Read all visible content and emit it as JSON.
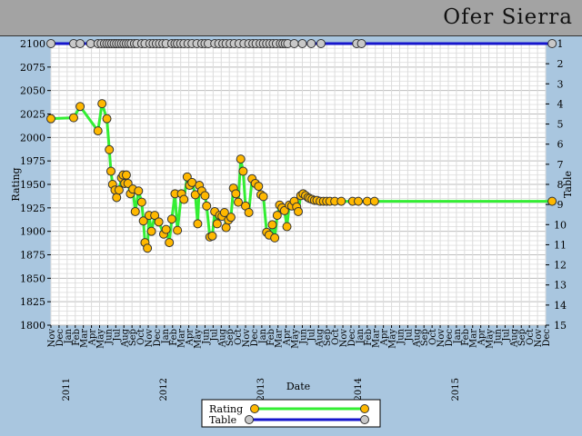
{
  "header": {
    "player_name": "Ofer Sierra"
  },
  "colors": {
    "rating_line": "#33ee33",
    "table_line": "#1515cc",
    "rating_marker": "#ffb800",
    "table_marker": "#c8c8c8",
    "background": "#a9c6df",
    "title_bar": "#a3a3a3"
  },
  "chart_data": {
    "type": "line",
    "title": "",
    "xlabel": "Date",
    "ylabel": "Rating",
    "y2label": "Table",
    "ylim": [
      1800,
      2100
    ],
    "y2lim": [
      1,
      15
    ],
    "y_ticks": [
      "1800",
      "1825",
      "1850",
      "1875",
      "1900",
      "1925",
      "1950",
      "1975",
      "2000",
      "2025",
      "2050",
      "2075",
      "2100"
    ],
    "y2_ticks": [
      "1",
      "2",
      "3",
      "4",
      "5",
      "6",
      "7",
      "8",
      "9",
      "10",
      "11",
      "12",
      "13",
      "14",
      "15"
    ],
    "month_ticks": [
      "Nov",
      "Dec",
      "Jan",
      "Feb",
      "Mar",
      "Apr",
      "May",
      "Jun",
      "Jul",
      "Aug",
      "Sep",
      "Oct",
      "Nov",
      "Dec",
      "Jan",
      "Feb",
      "Mar",
      "Apr",
      "May",
      "Jun",
      "Jul",
      "Aug",
      "Sep",
      "Oct",
      "Nov",
      "Dec",
      "Jan",
      "Feb",
      "Mar",
      "Apr",
      "May",
      "Jun",
      "Jul",
      "Aug",
      "Sep",
      "Oct",
      "Nov",
      "Dec",
      "Jan",
      "Feb",
      "Mar",
      "Apr",
      "May",
      "Jun",
      "Jul",
      "Aug",
      "Sep",
      "Oct",
      "Nov",
      "Dec",
      "Jan",
      "Feb",
      "Mar",
      "Apr",
      "May",
      "Jun",
      "Jul",
      "Aug",
      "Sep",
      "Oct",
      "Nov",
      "Dec"
    ],
    "year_labels": [
      {
        "label": "2011",
        "month_index": 2
      },
      {
        "label": "2012",
        "month_index": 14
      },
      {
        "label": "2013",
        "month_index": 26
      },
      {
        "label": "2014",
        "month_index": 38
      },
      {
        "label": "2015",
        "month_index": 50
      }
    ],
    "legend": {
      "placement": "bottom-center",
      "entries": [
        "Rating",
        "Table"
      ]
    },
    "grid": true,
    "series": [
      {
        "name": "Rating",
        "axis": "left",
        "x": [
          0,
          2.8,
          3.6,
          5.8,
          6.3,
          6.9,
          7.2,
          7.4,
          7.6,
          7.9,
          8.1,
          8.4,
          8.7,
          8.9,
          9.1,
          9.3,
          9.5,
          9.8,
          10.1,
          10.4,
          10.8,
          11.2,
          11.4,
          11.6,
          11.9,
          12.1,
          12.4,
          12.8,
          13.3,
          13.9,
          14.2,
          14.6,
          14.9,
          15.3,
          15.6,
          16.1,
          16.4,
          16.8,
          17.1,
          17.4,
          17.8,
          18.1,
          18.3,
          18.6,
          19.0,
          19.2,
          19.6,
          19.9,
          20.2,
          20.5,
          20.8,
          21.1,
          21.4,
          21.6,
          21.9,
          22.2,
          22.5,
          22.8,
          23.1,
          23.4,
          23.7,
          24.0,
          24.4,
          24.8,
          25.2,
          25.6,
          25.9,
          26.2,
          26.6,
          26.9,
          27.3,
          27.6,
          27.9,
          28.2,
          28.5,
          28.8,
          29.1,
          29.4,
          29.7,
          30.0,
          30.3,
          30.5,
          30.8,
          31.1,
          31.4,
          31.7,
          31.9,
          32.2,
          32.5,
          32.8,
          33.2,
          33.6,
          34.0,
          34.4,
          35.0,
          35.8,
          37.2,
          37.9,
          39.0,
          39.9,
          61.8
        ],
        "y": [
          2020,
          2021,
          2033,
          2007,
          2036,
          2020,
          1987,
          1964,
          1950,
          1944,
          1936,
          1944,
          1957,
          1960,
          1951,
          1960,
          1951,
          1940,
          1945,
          1921,
          1943,
          1931,
          1911,
          1888,
          1882,
          1917,
          1900,
          1917,
          1910,
          1897,
          1902,
          1888,
          1913,
          1940,
          1901,
          1940,
          1934,
          1958,
          1949,
          1952,
          1939,
          1908,
          1949,
          1943,
          1938,
          1927,
          1894,
          1895,
          1921,
          1908,
          1917,
          1916,
          1920,
          1904,
          1912,
          1915,
          1946,
          1940,
          1931,
          1977,
          1964,
          1927,
          1920,
          1956,
          1951,
          1948,
          1939,
          1937,
          1899,
          1896,
          1907,
          1893,
          1917,
          1928,
          1925,
          1922,
          1905,
          1928,
          1927,
          1932,
          1926,
          1921,
          1938,
          1940,
          1938,
          1936,
          1935,
          1934,
          1933,
          1933,
          1932,
          1932,
          1932,
          1932,
          1932,
          1932,
          1932,
          1932,
          1932,
          1932,
          1932
        ]
      },
      {
        "name": "Table",
        "axis": "right",
        "x": [
          0,
          2.8,
          3.6,
          4.9,
          5.8,
          6.2,
          6.6,
          6.9,
          7.2,
          7.5,
          7.8,
          8.1,
          8.4,
          8.7,
          9.0,
          9.3,
          9.6,
          9.9,
          10.3,
          10.6,
          11.2,
          11.6,
          12.2,
          12.6,
          13.0,
          13.4,
          13.8,
          14.2,
          14.9,
          15.3,
          15.6,
          16.0,
          16.4,
          16.9,
          17.4,
          18.0,
          18.6,
          19.0,
          19.4,
          20.2,
          20.7,
          21.2,
          21.6,
          22.1,
          22.6,
          23.2,
          23.8,
          24.4,
          24.9,
          25.3,
          25.8,
          26.2,
          26.6,
          27.0,
          27.4,
          27.8,
          28.3,
          28.6,
          28.9,
          29.2,
          30.0,
          31.0,
          32.1,
          33.3,
          37.7,
          38.3,
          61.8
        ],
        "y": [
          1,
          1,
          1,
          1,
          1,
          1,
          1,
          1,
          1,
          1,
          1,
          1,
          1,
          1,
          1,
          1,
          1,
          1,
          1,
          1,
          1,
          1,
          1,
          1,
          1,
          1,
          1,
          1,
          1,
          1,
          1,
          1,
          1,
          1,
          1,
          1,
          1,
          1,
          1,
          1,
          1,
          1,
          1,
          1,
          1,
          1,
          1,
          1,
          1,
          1,
          1,
          1,
          1,
          1,
          1,
          1,
          1,
          1,
          1,
          1,
          1,
          1,
          1,
          1,
          1,
          1,
          1
        ]
      }
    ]
  }
}
